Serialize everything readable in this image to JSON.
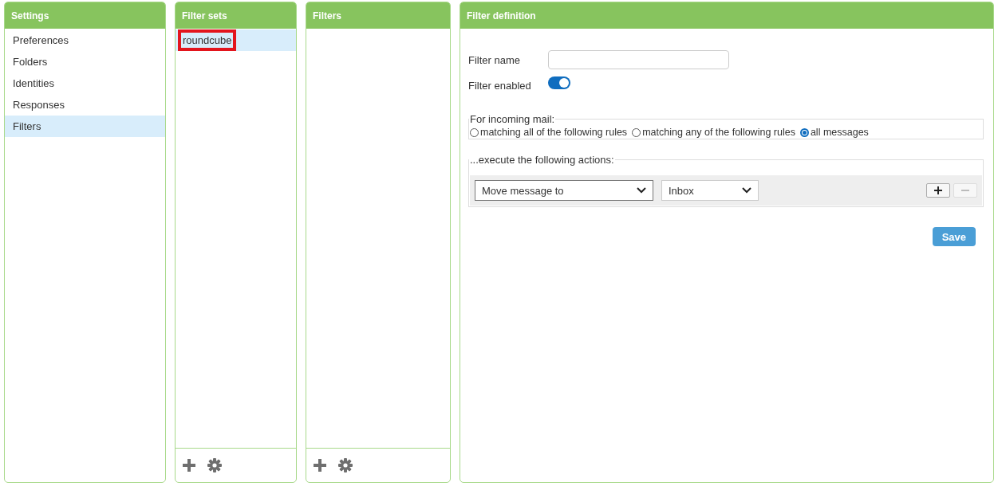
{
  "settings": {
    "title": "Settings",
    "items": [
      {
        "label": "Preferences",
        "selected": false
      },
      {
        "label": "Folders",
        "selected": false
      },
      {
        "label": "Identities",
        "selected": false
      },
      {
        "label": "Responses",
        "selected": false
      },
      {
        "label": "Filters",
        "selected": true
      }
    ]
  },
  "filter_sets": {
    "title": "Filter sets",
    "items": [
      {
        "label": "roundcube",
        "selected": true,
        "highlighted": true
      }
    ]
  },
  "filters": {
    "title": "Filters"
  },
  "filter_definition": {
    "title": "Filter definition",
    "filter_name": {
      "label": "Filter name"
    },
    "filter_enabled": {
      "label": "Filter enabled",
      "on": true
    },
    "incoming": {
      "legend": "For incoming mail:",
      "options": [
        {
          "label": "matching all of the following rules",
          "selected": false
        },
        {
          "label": "matching any of the following rules",
          "selected": false
        },
        {
          "label": "all messages",
          "selected": true
        }
      ]
    },
    "actions": {
      "legend": "...execute the following actions:",
      "rows": [
        {
          "action": "Move message to",
          "target": "Inbox",
          "add_disabled": false,
          "remove_disabled": true
        }
      ]
    },
    "save": "Save"
  }
}
